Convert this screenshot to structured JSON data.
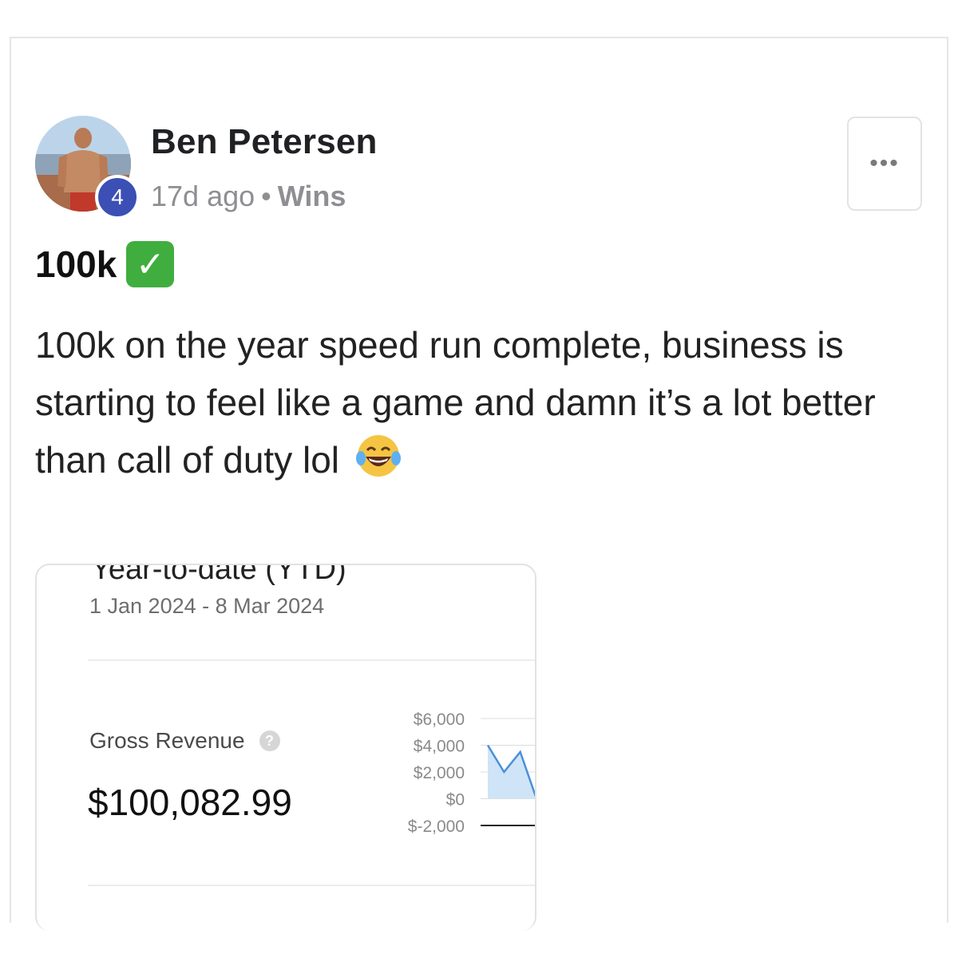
{
  "post": {
    "author": "Ben Petersen",
    "level": "4",
    "time": "17d ago",
    "separator": "•",
    "category": "Wins",
    "more_label": "•••",
    "title": "100k",
    "title_icon": "check-mark-button-icon",
    "body": "100k on the year speed run complete, business is starting to feel like a game and damn it’s a lot better than call of duty lol",
    "body_icon": "tears-of-joy-emoji-icon"
  },
  "screenshot": {
    "title": "Year-to-date (YTD)",
    "date_range": "1 Jan 2024 - 8 Mar 2024",
    "metric_label": "Gross Revenue",
    "help_glyph": "?",
    "metric_value": "$100,082.99"
  },
  "colors": {
    "badge": "#3b4fb5",
    "line": "#4a90d9",
    "area": "#cfe4f7"
  },
  "chart_data": {
    "type": "area",
    "y_ticks": [
      "$6,000",
      "$4,000",
      "$2,000",
      "$0",
      "$-2,000"
    ],
    "y_tick_values": [
      6000,
      4000,
      2000,
      0,
      -2000
    ],
    "ylim": [
      -2000,
      6000
    ],
    "series": [
      {
        "values": [
          4000,
          2000,
          3500,
          0
        ]
      }
    ],
    "grid": true
  }
}
